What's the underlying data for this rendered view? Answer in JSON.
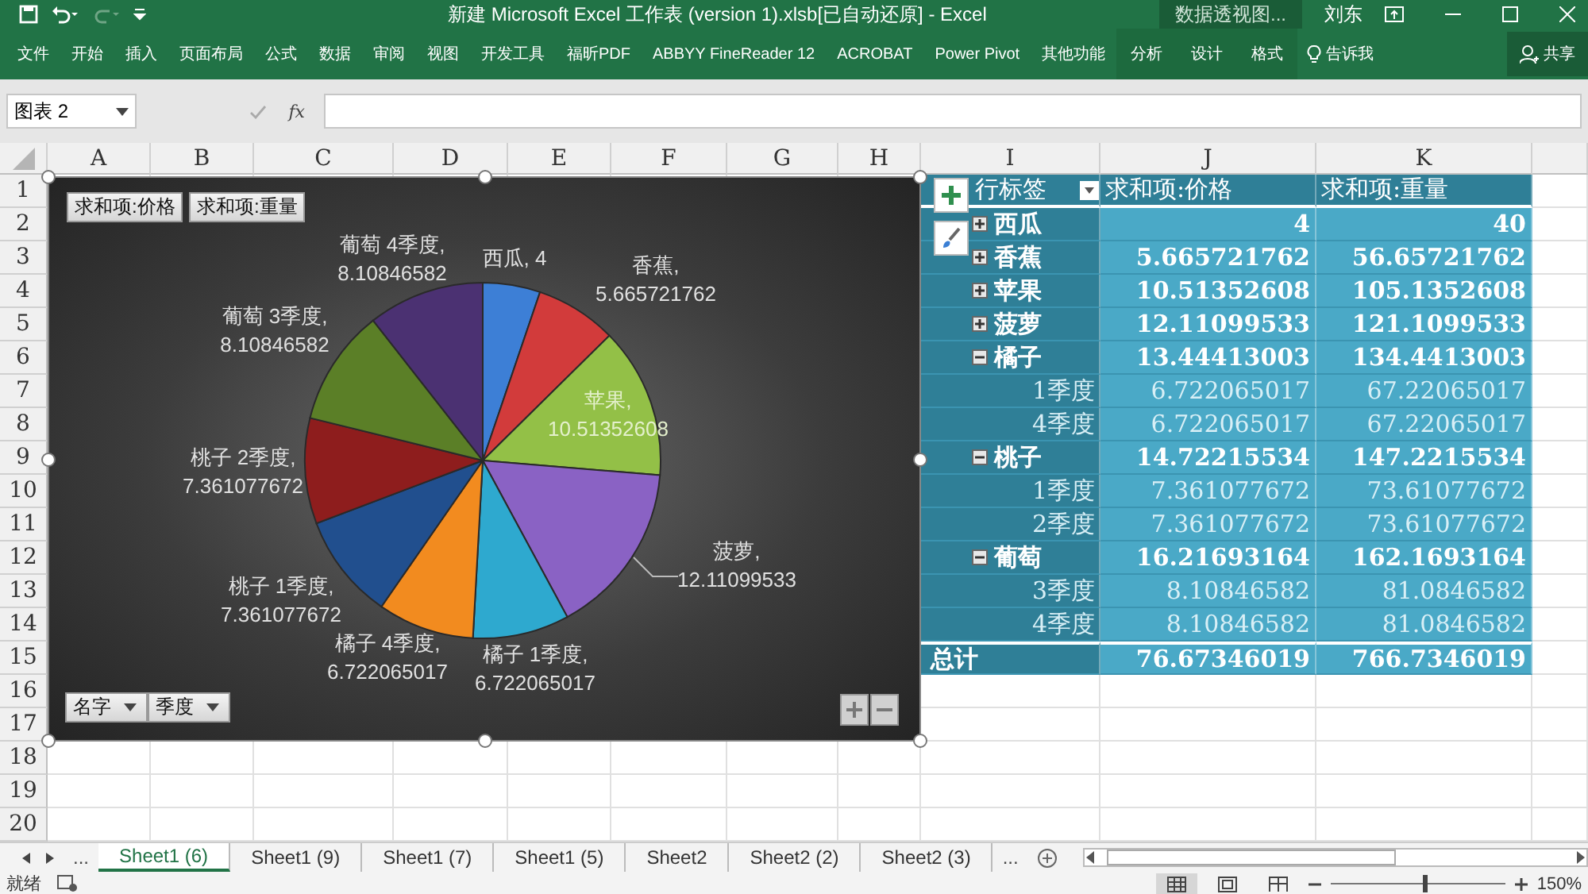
{
  "window": {
    "title": "新建 Microsoft Excel 工作表 (version 1).xlsb[已自动还原] - Excel",
    "context_title": "数据透视图...",
    "user": "刘东"
  },
  "ribbon_tabs": [
    {
      "label": "文件",
      "kind": "tab",
      "selected": false
    },
    {
      "label": "开始",
      "kind": "tab",
      "selected": false
    },
    {
      "label": "插入",
      "kind": "tab",
      "selected": false
    },
    {
      "label": "页面布局",
      "kind": "tab",
      "selected": false
    },
    {
      "label": "公式",
      "kind": "tab",
      "selected": false
    },
    {
      "label": "数据",
      "kind": "tab",
      "selected": false
    },
    {
      "label": "审阅",
      "kind": "tab",
      "selected": false
    },
    {
      "label": "视图",
      "kind": "tab",
      "selected": false
    },
    {
      "label": "开发工具",
      "kind": "tab",
      "selected": false
    },
    {
      "label": "福昕PDF",
      "kind": "tab",
      "selected": false
    },
    {
      "label": "ABBYY FineReader 12",
      "kind": "tab",
      "selected": false
    },
    {
      "label": "ACROBAT",
      "kind": "tab",
      "selected": false
    },
    {
      "label": "Power Pivot",
      "kind": "tab",
      "selected": false
    },
    {
      "label": "其他功能",
      "kind": "tab",
      "selected": false
    },
    {
      "label": "分析",
      "kind": "contextual",
      "selected": false
    },
    {
      "label": "设计",
      "kind": "contextual",
      "selected": false
    },
    {
      "label": "格式",
      "kind": "contextual",
      "selected": false
    }
  ],
  "tell_me": "告诉我",
  "share": "共享",
  "name_box": "图表 2",
  "fx": "fx",
  "columns": [
    "A",
    "B",
    "C",
    "D",
    "E",
    "F",
    "G",
    "H",
    "I",
    "J",
    "K"
  ],
  "rows": [
    "1",
    "2",
    "3",
    "4",
    "5",
    "6",
    "7",
    "8",
    "9",
    "10",
    "11",
    "12",
    "13",
    "14",
    "15",
    "16",
    "17",
    "18",
    "19",
    "20"
  ],
  "chart": {
    "value_buttons": [
      "求和项:价格",
      "求和项:重量"
    ],
    "axis_buttons": [
      "名字",
      "季度"
    ],
    "chart_data": {
      "type": "pie",
      "categories": [
        "西瓜",
        "香蕉",
        "苹果",
        "菠萝",
        "橘子 1季度",
        "橘子 4季度",
        "桃子 1季度",
        "桃子 2季度",
        "葡萄 3季度",
        "葡萄 4季度"
      ],
      "series": [
        {
          "values": [
            4,
            5.665721762,
            10.51352608,
            12.11099533,
            6.722065017,
            6.722065017,
            7.361077672,
            7.361077672,
            8.10846582,
            8.10846582
          ]
        }
      ],
      "data_labels": true
    },
    "label_separator": ","
  },
  "pivot": {
    "header": [
      "行标签",
      "求和项:价格",
      "求和项:重量"
    ],
    "rows": [
      {
        "label": "西瓜",
        "price": "4",
        "weight": "40",
        "expanded": false
      },
      {
        "label": "香蕉",
        "price": "5.665721762",
        "weight": "56.65721762",
        "expanded": false
      },
      {
        "label": "苹果",
        "price": "10.51352608",
        "weight": "105.1352608",
        "expanded": false
      },
      {
        "label": "菠萝",
        "price": "12.11099533",
        "weight": "121.1099533",
        "expanded": false
      },
      {
        "label": "橘子",
        "price": "13.44413003",
        "weight": "134.4413003",
        "expanded": true,
        "children": [
          {
            "label": "1季度",
            "price": "6.722065017",
            "weight": "67.22065017"
          },
          {
            "label": "4季度",
            "price": "6.722065017",
            "weight": "67.22065017"
          }
        ]
      },
      {
        "label": "桃子",
        "price": "14.72215534",
        "weight": "147.2215534",
        "expanded": true,
        "children": [
          {
            "label": "1季度",
            "price": "7.361077672",
            "weight": "73.61077672"
          },
          {
            "label": "2季度",
            "price": "7.361077672",
            "weight": "73.61077672"
          }
        ]
      },
      {
        "label": "葡萄",
        "price": "16.21693164",
        "weight": "162.1693164",
        "expanded": true,
        "children": [
          {
            "label": "3季度",
            "price": "8.10846582",
            "weight": "81.0846582"
          },
          {
            "label": "4季度",
            "price": "8.10846582",
            "weight": "81.0846582"
          }
        ]
      }
    ],
    "total": {
      "label": "总计",
      "price": "76.67346019",
      "weight": "766.7346019"
    }
  },
  "sheet_tabs": [
    {
      "label": "Sheet1 (6)",
      "selected": true
    },
    {
      "label": "Sheet1 (9)",
      "selected": false
    },
    {
      "label": "Sheet1 (7)",
      "selected": false
    },
    {
      "label": "Sheet1 (5)",
      "selected": false
    },
    {
      "label": "Sheet2",
      "selected": false
    },
    {
      "label": "Sheet2 (2)",
      "selected": false
    },
    {
      "label": "Sheet2 (3)",
      "selected": false
    }
  ],
  "sheet_more": [
    "...",
    "..."
  ],
  "status_bar": {
    "text": "就绪",
    "zoom": "150%",
    "zoom_slider": {
      "level": 0.55
    }
  }
}
